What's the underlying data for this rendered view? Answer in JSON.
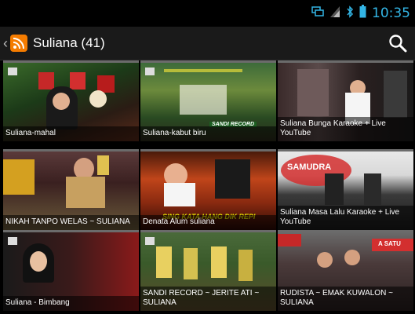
{
  "status": {
    "time": "10:35"
  },
  "actionbar": {
    "title": "Suliana (41)"
  },
  "tiles": [
    {
      "caption": "Suliana-mahal"
    },
    {
      "caption": "Suliana-kabut biru"
    },
    {
      "caption": "Suliana Bunga Karaoke + Live YouTube"
    },
    {
      "caption": "NIKAH TANPO WELAS ~ SULIANA"
    },
    {
      "caption": "Denata Alum suliana"
    },
    {
      "caption": "Suliana Masa Lalu Karaoke + Live YouTube"
    },
    {
      "caption": "Suliana - Bimbang"
    },
    {
      "caption": "SANDI RECORD ~ JERITE ATI ~ SULIANA"
    },
    {
      "caption": "RUDISTA ~ EMAK KUWALON ~ SULIANA"
    }
  ],
  "thumb_text": {
    "t2": "SANDI RECORD",
    "t5": "SING KATA HANG DIK REPI",
    "t6": "SAMUDRA",
    "t9": "A SATU"
  },
  "colors": {
    "accent": "#33b5e5",
    "rss": "#f57c00"
  }
}
